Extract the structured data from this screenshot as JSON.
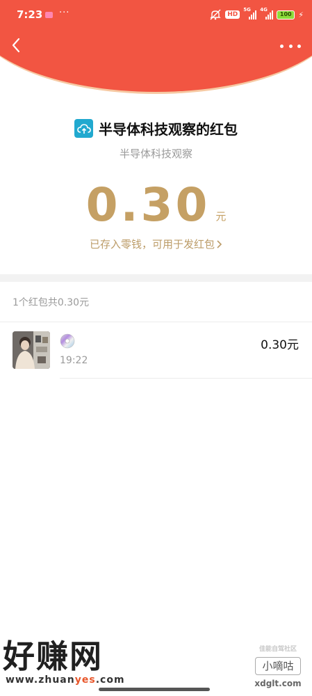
{
  "status_bar": {
    "time": "7:23",
    "dots": "···",
    "hd": "HD",
    "network_1": "5G",
    "network_2": "4G",
    "battery": "100"
  },
  "header": {
    "title": "半导体科技观察的红包",
    "subtitle": "半导体科技观察"
  },
  "amount": {
    "value": "0.30",
    "unit": "元",
    "deposit_link": "已存入零钱，可用于发红包"
  },
  "summary": "1个红包共0.30元",
  "records": [
    {
      "time": "19:22",
      "amount": "0.30元"
    }
  ],
  "watermark_left": {
    "main": "好赚网",
    "url_pre": "www.zhuan",
    "url_hl": "yes",
    "url_post": ".com"
  },
  "watermark_right": {
    "top": "佳能自驾社区",
    "mid": "小嘀咕",
    "bottom": "xdglt.com"
  },
  "colors": {
    "header_red": "#f25542",
    "amount_gold": "#c5a064",
    "logo_blue": "#21a9cf"
  },
  "icons": [
    "back-arrow-icon",
    "more-dots-icon",
    "cloud-upload-icon",
    "chevron-right-icon",
    "disc-icon"
  ]
}
